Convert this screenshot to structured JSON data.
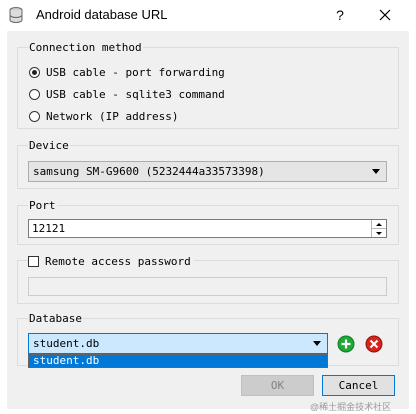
{
  "window": {
    "title": "Android database URL",
    "help_label": "?",
    "close_icon": "close-icon"
  },
  "connection": {
    "label": "Connection method",
    "options": [
      {
        "label": "USB cable - port forwarding",
        "checked": true
      },
      {
        "label": "USB cable - sqlite3 command",
        "checked": false
      },
      {
        "label": "Network (IP address)",
        "checked": false
      }
    ]
  },
  "device": {
    "label": "Device",
    "selected": "samsung SM-G9600 (5232444a33573398)"
  },
  "port": {
    "label": "Port",
    "value": "12121"
  },
  "remote": {
    "checkbox_label": "Remote access password",
    "checked": false,
    "password_value": ""
  },
  "database": {
    "label": "Database",
    "selected": "student.db",
    "dropdown_items": [
      "student.db"
    ],
    "add_icon": "plus-icon",
    "remove_icon": "remove-icon"
  },
  "buttons": {
    "ok_label": "OK",
    "cancel_label": "Cancel"
  },
  "watermark": "@稀土掘金技术社区",
  "colors": {
    "accent": "#0078d7",
    "add": "#1ea838",
    "remove": "#d9221c"
  }
}
